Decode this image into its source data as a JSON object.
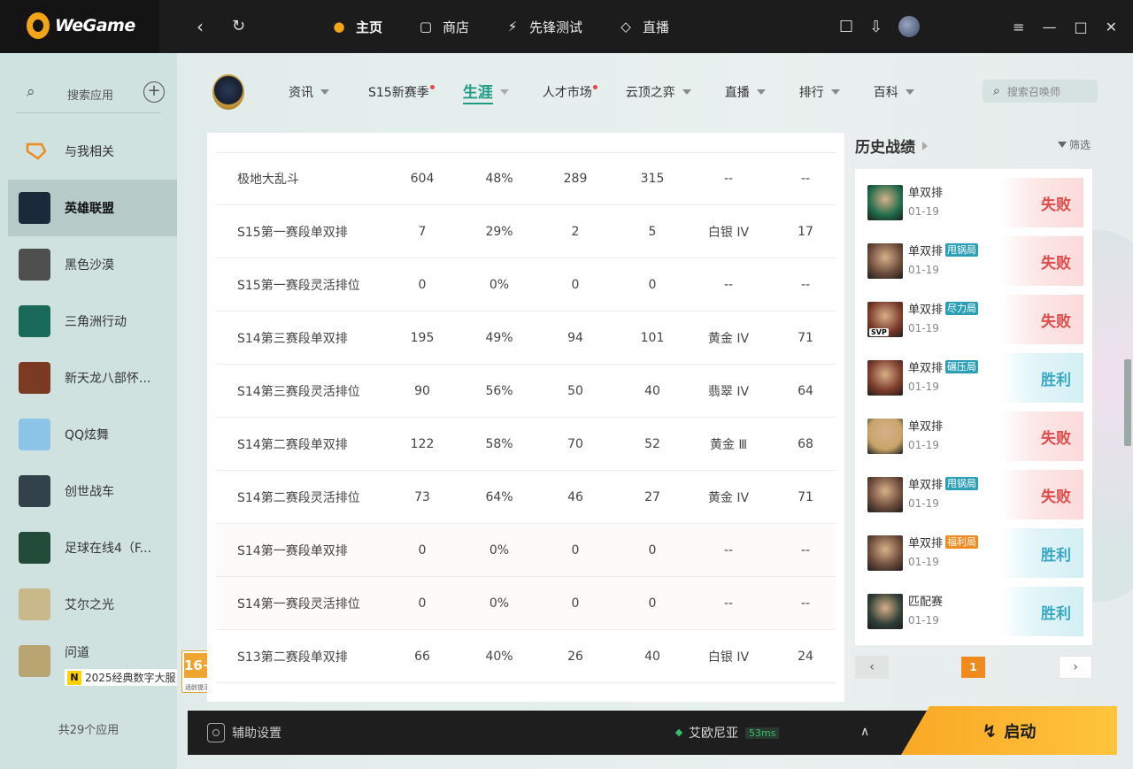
{
  "app": {
    "name": "WeGame"
  },
  "topnav": [
    {
      "label": "主页",
      "icon": "home-icon",
      "active": true
    },
    {
      "label": "商店",
      "icon": "shop-icon",
      "active": false
    },
    {
      "label": "先锋测试",
      "icon": "pioneer-icon",
      "active": false
    },
    {
      "label": "直播",
      "icon": "live-icon",
      "active": false
    }
  ],
  "sidebar": {
    "search_label": "搜索应用",
    "items": [
      {
        "name": "与我相关",
        "icon": "related-icon",
        "color": "#e8e2dc"
      },
      {
        "name": "英雄联盟",
        "icon": "lol-icon",
        "color": "#1b2a3a",
        "active": true
      },
      {
        "name": "黑色沙漠",
        "icon": "black-desert-icon",
        "color": "#4f4f4f"
      },
      {
        "name": "三角洲行动",
        "icon": "delta-force-icon",
        "color": "#1a6a5a"
      },
      {
        "name": "新天龙八部怀...",
        "icon": "tianlong-icon",
        "color": "#7a3b22"
      },
      {
        "name": "QQ炫舞",
        "icon": "qq-dance-icon",
        "color": "#8cc4e8"
      },
      {
        "name": "创世战车",
        "icon": "crossout-icon",
        "color": "#33414a"
      },
      {
        "name": "足球在线4（F...",
        "icon": "fifa-online-icon",
        "color": "#234b3a"
      },
      {
        "name": "艾尔之光",
        "icon": "elsword-icon",
        "color": "#c9b98a"
      },
      {
        "name": "问道",
        "icon": "wendao-icon",
        "color": "#b8a572",
        "sub": "2025经典数字大服",
        "sub_badge": "N"
      }
    ],
    "count_label": "共29个应用"
  },
  "age_badge": {
    "rating": "16+",
    "label": "适龄提示"
  },
  "gamenav": {
    "items": [
      {
        "label": "资讯",
        "caret": true,
        "dot": false
      },
      {
        "label": "S15新赛季",
        "caret": false,
        "dot": true
      },
      {
        "label": "生涯",
        "caret": true,
        "dot": false,
        "active": true
      },
      {
        "label": "人才市场",
        "caret": false,
        "dot": true
      },
      {
        "label": "云顶之弈",
        "caret": true,
        "dot": false
      },
      {
        "label": "直播",
        "caret": true,
        "dot": false
      },
      {
        "label": "排行",
        "caret": true,
        "dot": false
      },
      {
        "label": "百科",
        "caret": true,
        "dot": false
      }
    ],
    "search_placeholder": "搜索召唤师"
  },
  "stats_table": {
    "rows": [
      [
        "极地大乱斗",
        "604",
        "48%",
        "289",
        "315",
        "--",
        "--"
      ],
      [
        "S15第一赛段单双排",
        "7",
        "29%",
        "2",
        "5",
        "白银 IV",
        "17"
      ],
      [
        "S15第一赛段灵活排位",
        "0",
        "0%",
        "0",
        "0",
        "--",
        "--"
      ],
      [
        "S14第三赛段单双排",
        "195",
        "49%",
        "94",
        "101",
        "黄金 IV",
        "71"
      ],
      [
        "S14第三赛段灵活排位",
        "90",
        "56%",
        "50",
        "40",
        "翡翠 IV",
        "64"
      ],
      [
        "S14第二赛段单双排",
        "122",
        "58%",
        "70",
        "52",
        "黄金 Ⅲ",
        "68"
      ],
      [
        "S14第二赛段灵活排位",
        "73",
        "64%",
        "46",
        "27",
        "黄金 IV",
        "71"
      ],
      [
        "S14第一赛段单双排",
        "0",
        "0%",
        "0",
        "0",
        "--",
        "--"
      ],
      [
        "S14第一赛段灵活排位",
        "0",
        "0%",
        "0",
        "0",
        "--",
        "--"
      ],
      [
        "S13第二赛段单双排",
        "66",
        "40%",
        "26",
        "40",
        "白银 IV",
        "24"
      ]
    ]
  },
  "history": {
    "title": "历史战绩",
    "filter_label": "筛选",
    "matches": [
      {
        "mode": "单双排",
        "tag": "",
        "tag_color": "",
        "date": "01-19",
        "result": "失败",
        "win": false,
        "champ_color": "#1f6b4a",
        "svp": false
      },
      {
        "mode": "单双排",
        "tag": "甩锅局",
        "tag_color": "#2a9fb5",
        "date": "01-19",
        "result": "失败",
        "win": false,
        "champ_color": "#6a4a3a",
        "svp": false
      },
      {
        "mode": "单双排",
        "tag": "尽力局",
        "tag_color": "#2a9fb5",
        "date": "01-19",
        "result": "失败",
        "win": false,
        "champ_color": "#7a3a2a",
        "svp": true,
        "svp_label": "SVP"
      },
      {
        "mode": "单双排",
        "tag": "碾压局",
        "tag_color": "#2a9fb5",
        "date": "01-19",
        "result": "胜利",
        "win": true,
        "champ_color": "#7a3a2a",
        "svp": false
      },
      {
        "mode": "单双排",
        "tag": "",
        "tag_color": "",
        "date": "01-19",
        "result": "失败",
        "win": false,
        "champ_color": "#c8a46a",
        "svp": false
      },
      {
        "mode": "单双排",
        "tag": "甩锅局",
        "tag_color": "#2a9fb5",
        "date": "01-19",
        "result": "失败",
        "win": false,
        "champ_color": "#6a4a3a",
        "svp": false
      },
      {
        "mode": "单双排",
        "tag": "福利局",
        "tag_color": "#f08a1c",
        "date": "01-19",
        "result": "胜利",
        "win": true,
        "champ_color": "#6a4a3a",
        "svp": false
      },
      {
        "mode": "匹配赛",
        "tag": "",
        "tag_color": "",
        "date": "01-19",
        "result": "胜利",
        "win": true,
        "champ_color": "#2f3f36",
        "svp": false
      }
    ],
    "page": "1"
  },
  "bottombar": {
    "assist_label": "辅助设置",
    "server": "艾欧尼亚",
    "ping": "53ms",
    "launch_label": "启动"
  }
}
